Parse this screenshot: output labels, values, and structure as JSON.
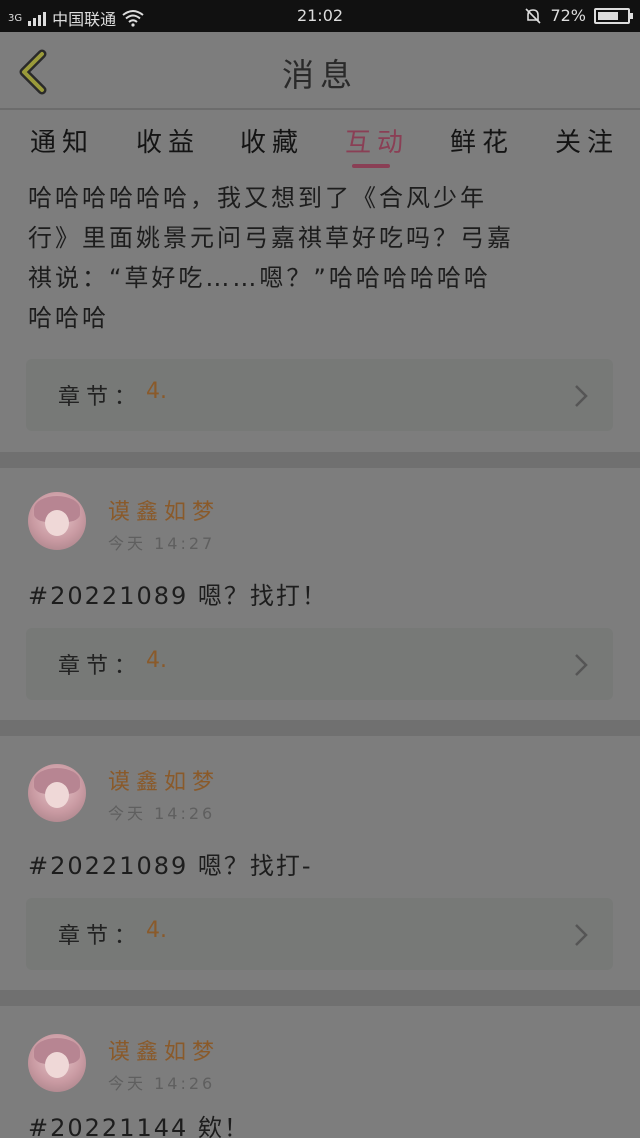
{
  "status_bar": {
    "network": "3G",
    "carrier": "中国联通",
    "time": "21:02",
    "battery_text": "72%",
    "battery_level": 0.72
  },
  "header": {
    "title": "消息"
  },
  "tabs": [
    {
      "label": "通知"
    },
    {
      "label": "收益"
    },
    {
      "label": "收藏"
    },
    {
      "label": "互动",
      "active": true
    },
    {
      "label": "鲜花"
    },
    {
      "label": "关注"
    }
  ],
  "messages": [
    {
      "text_lines": [
        "哈哈哈哈哈哈，我又想到了《合风少年",
        "行》里面姚景元问弓嘉祺草好吃吗？弓嘉",
        "祺说：“草好吃……嗯？”哈哈哈哈哈哈",
        "哈哈哈"
      ],
      "chapter_label": "章节：",
      "chapter_value": "4."
    },
    {
      "user": "谟鑫如梦",
      "time": "今天 14:27",
      "text": "#20221089 嗯？找打！",
      "chapter_label": "章节：",
      "chapter_value": "4."
    },
    {
      "user": "谟鑫如梦",
      "time": "今天 14:26",
      "text": "#20221089 嗯？找打-",
      "chapter_label": "章节：",
      "chapter_value": "4."
    },
    {
      "user": "谟鑫如梦",
      "time": "今天 14:26",
      "text": "#20221144 欸！"
    }
  ],
  "colors": {
    "accent": "#8a3f55",
    "username": "#8a5a2a"
  }
}
